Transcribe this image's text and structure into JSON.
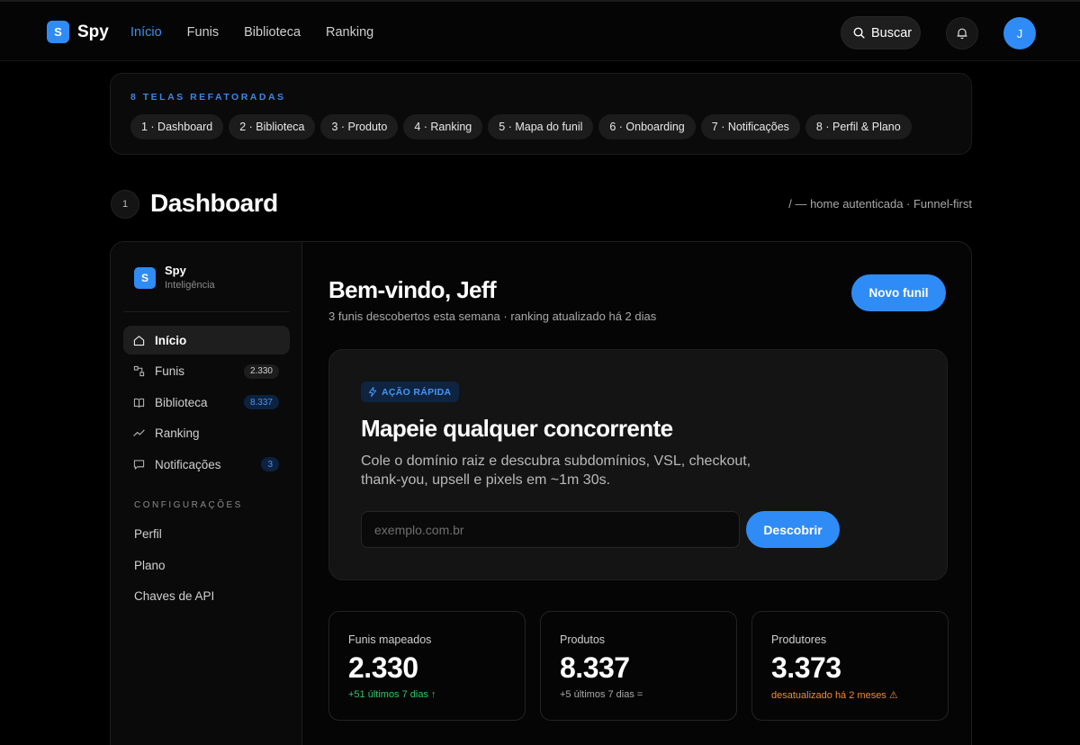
{
  "topnav": {
    "logo_letter": "S",
    "brand": "Spy",
    "links": [
      "Início",
      "Funis",
      "Biblioteca",
      "Ranking"
    ],
    "active_link": "Início",
    "search_label": "Buscar",
    "avatar_initial": "J"
  },
  "screens": {
    "title": "8 TELAS REFATORADAS",
    "chips": [
      "1 · Dashboard",
      "2 · Biblioteca",
      "3 · Produto",
      "4 · Ranking",
      "5 · Mapa do funil",
      "6 · Onboarding",
      "7 · Notificações",
      "8 · Perfil & Plano"
    ]
  },
  "section": {
    "number": "1",
    "title": "Dashboard",
    "subtitle": "/ — home autenticada · Funnel-first"
  },
  "sidebar": {
    "logo_letter": "S",
    "brand": "Spy",
    "brand_sub": "Inteligência",
    "items": [
      {
        "label": "Início",
        "icon": "home-icon",
        "badge": ""
      },
      {
        "label": "Funis",
        "icon": "funnel-icon",
        "badge": "2.330"
      },
      {
        "label": "Biblioteca",
        "icon": "book-icon",
        "badge": "8.337"
      },
      {
        "label": "Ranking",
        "icon": "trend-icon",
        "badge": ""
      },
      {
        "label": "Notificações",
        "icon": "message-icon",
        "badge": "3"
      }
    ],
    "config_title": "CONFIGURAÇÕES",
    "config_items": [
      "Perfil",
      "Plano",
      "Chaves de API"
    ]
  },
  "main": {
    "welcome": "Bem-vindo, Jeff",
    "welcome_sub": "3 funis descobertos esta semana · ranking atualizado há 2 dias",
    "new_funnel_label": "Novo funil",
    "quick": {
      "badge": "AÇÃO RÁPIDA",
      "title": "Mapeie qualquer concorrente",
      "description": "Cole o domínio raiz e descubra subdomínios, VSL, checkout, thank-you, upsell e pixels em ~1m 30s.",
      "input_value": "",
      "input_placeholder": "exemplo.com.br",
      "button_label": "Descobrir"
    },
    "stats": [
      {
        "label": "Funis mapeados",
        "value": "2.330",
        "delta": "+51 últimos 7 dias ↑",
        "tone": "green"
      },
      {
        "label": "Produtos",
        "value": "8.337",
        "delta": "+5 últimos 7 dias =",
        "tone": "grey"
      },
      {
        "label": "Produtores",
        "value": "3.373",
        "delta": "desatualizado há 2 meses ⚠",
        "tone": "orange"
      }
    ]
  },
  "colors": {
    "accent": "#2f8cf6",
    "background": "#000000",
    "positive": "#34c46a",
    "warning": "#f08c2a"
  }
}
